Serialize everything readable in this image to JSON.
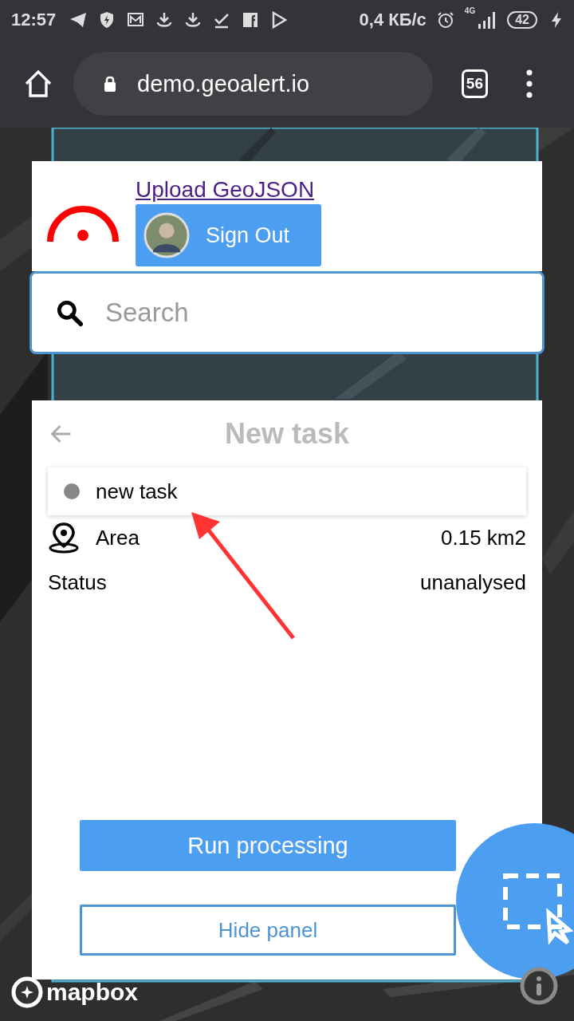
{
  "status_bar": {
    "time": "12:57",
    "net_speed": "0,4 КБ/с",
    "network": "4G",
    "battery": "42"
  },
  "browser": {
    "url": "demo.geoalert.io",
    "tab_count": "56"
  },
  "header": {
    "link": "Upload GeoJSON",
    "sign_out": "Sign Out"
  },
  "search": {
    "placeholder": "Search"
  },
  "panel": {
    "title": "New task",
    "task_name": "new task",
    "properties": [
      {
        "kind": "area",
        "label": "Area",
        "value": "0.15 km2"
      },
      {
        "kind": "status",
        "label": "Status",
        "value": "unanalysed"
      }
    ],
    "buttons": [
      {
        "kind": "primary",
        "label": "Run processing"
      },
      {
        "kind": "outline",
        "label": "Hide panel"
      }
    ]
  },
  "map": {
    "attribution": "mapbox"
  }
}
